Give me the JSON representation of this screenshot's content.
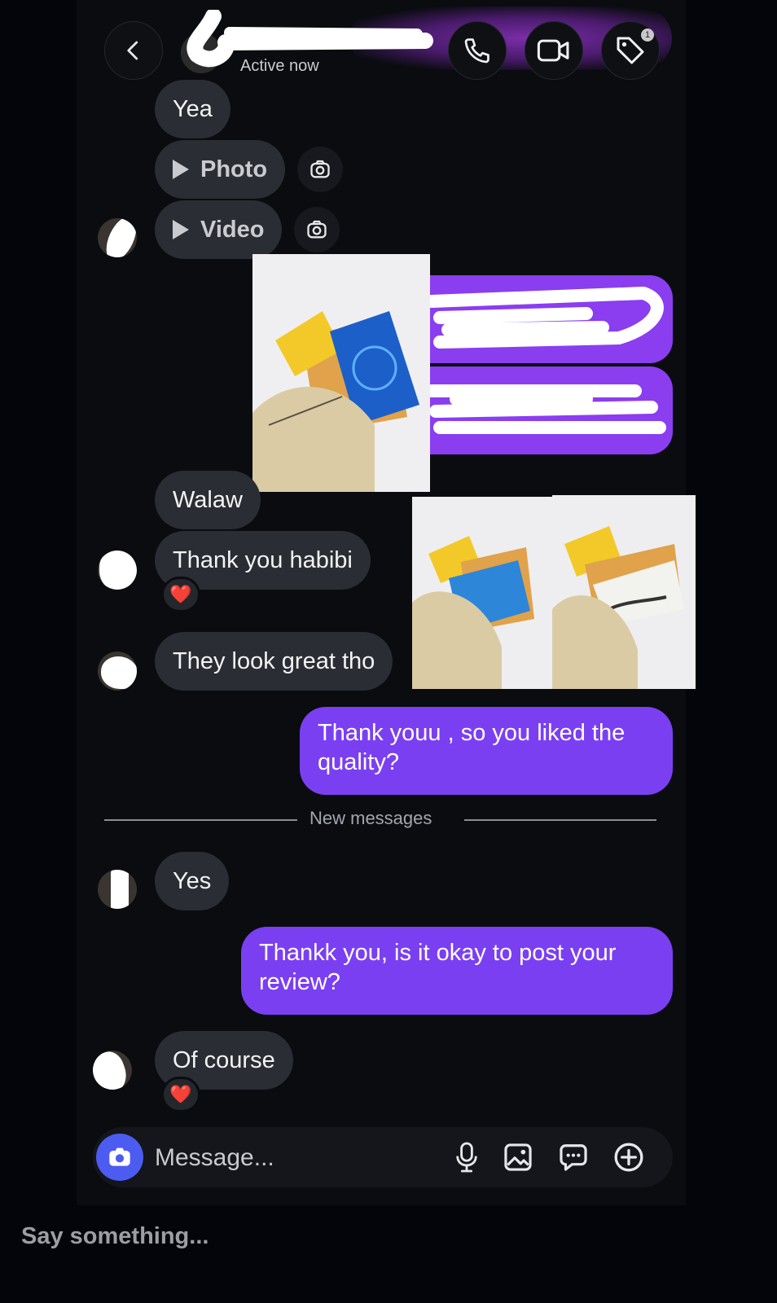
{
  "header": {
    "status": "Active now",
    "tag_badge": "1"
  },
  "messages": {
    "yea": "Yea",
    "photo": "Photo",
    "video": "Video",
    "walaw": "Walaw",
    "thank_you_habibi": "Thank you habibi",
    "look_great": "They look great tho",
    "thank_youu": "Thank youu , so you liked the quality?",
    "yes": "Yes",
    "thankk": "Thankk you, is it okay to post your review?",
    "of_course": "Of course"
  },
  "reactions": {
    "heart": "❤️"
  },
  "divider": {
    "label": "New messages"
  },
  "composer": {
    "placeholder": "Message..."
  },
  "story_reply": {
    "placeholder": "Say something..."
  },
  "icons": {
    "back": "chevron-left-icon",
    "call": "phone-icon",
    "video_call": "video-camera-icon",
    "tag": "tag-icon",
    "camera": "camera-icon",
    "mic": "microphone-icon",
    "gallery": "image-icon",
    "sticker": "chat-bubble-icon",
    "more": "plus-circle-icon"
  },
  "colors": {
    "outgoing_bubble": "#7b3ff2",
    "incoming_bubble": "#2a2d33",
    "composer_camera": "#4c5cf0",
    "heart": "#e0202c"
  }
}
